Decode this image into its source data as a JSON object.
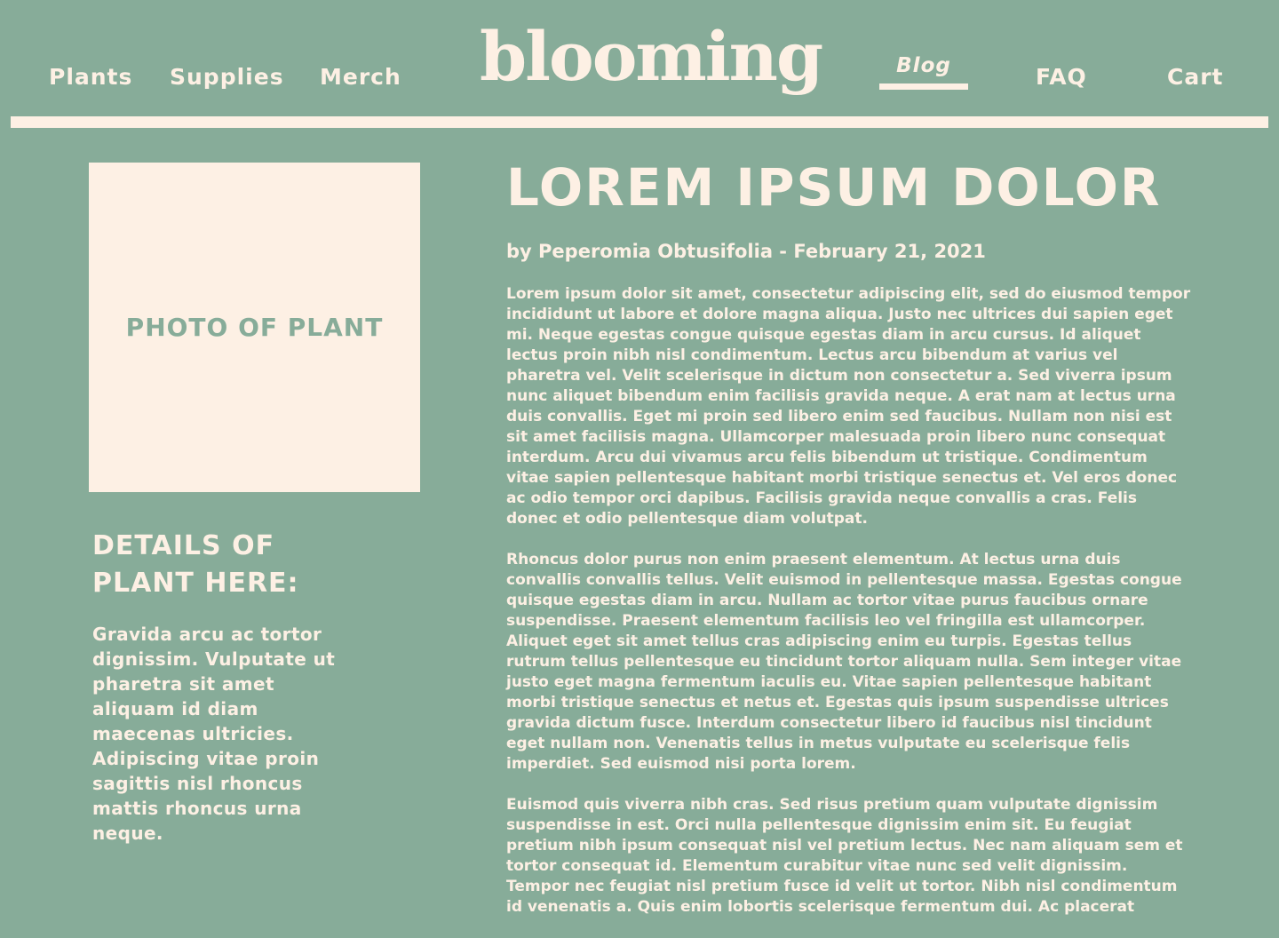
{
  "nav": {
    "plants": "Plants",
    "supplies": "Supplies",
    "merch": "Merch",
    "blog": "Blog",
    "faq": "FAQ",
    "cart": "Cart",
    "active": "Blog"
  },
  "logo": "blooming",
  "colors": {
    "background": "#87ac99",
    "cream": "#fdf0e4"
  },
  "sidebar": {
    "photo_placeholder": "PHOTO OF PLANT",
    "details_heading": "DETAILS OF PLANT HERE:",
    "details_body": "Gravida arcu ac tortor dignissim. Vulputate ut pharetra sit amet aliquam id diam maecenas ultricies. Adipiscing vitae proin sagittis nisl rhoncus mattis rhoncus urna neque."
  },
  "article": {
    "title": "LOREM IPSUM DOLOR",
    "byline": "by Peperomia Obtusifolia - February 21, 2021",
    "paragraphs": [
      "Lorem ipsum dolor sit amet, consectetur adipiscing elit, sed do eiusmod tempor incididunt ut labore et dolore magna aliqua. Justo nec ultrices dui sapien eget mi. Neque egestas congue quisque egestas diam in arcu cursus. Id aliquet lectus proin nibh nisl condimentum. Lectus arcu bibendum at varius vel pharetra vel. Velit scelerisque in dictum non consectetur a. Sed viverra ipsum nunc aliquet bibendum enim facilisis gravida neque. A erat nam at lectus urna duis convallis. Eget mi proin sed libero enim sed faucibus. Nullam non nisi est sit amet facilisis magna. Ullamcorper malesuada proin libero nunc consequat interdum. Arcu dui vivamus arcu felis bibendum ut tristique. Condimentum vitae sapien pellentesque habitant morbi tristique senectus et. Vel eros donec ac odio tempor orci dapibus. Facilisis gravida neque convallis a cras. Felis donec et odio pellentesque diam volutpat.",
      "Rhoncus dolor purus non enim praesent elementum. At lectus urna duis convallis convallis tellus. Velit euismod in pellentesque massa. Egestas congue quisque egestas diam in arcu. Nullam ac tortor vitae purus faucibus ornare suspendisse. Praesent elementum facilisis leo vel fringilla est ullamcorper. Aliquet eget sit amet tellus cras adipiscing enim eu turpis. Egestas tellus rutrum tellus pellentesque eu tincidunt tortor aliquam nulla. Sem integer vitae justo eget magna fermentum iaculis eu. Vitae sapien pellentesque habitant morbi tristique senectus et netus et. Egestas quis ipsum suspendisse ultrices gravida dictum fusce. Interdum consectetur libero id faucibus nisl tincidunt eget nullam non. Venenatis tellus in metus vulputate eu scelerisque felis imperdiet. Sed euismod nisi porta lorem.",
      "Euismod quis viverra nibh cras. Sed risus pretium quam vulputate dignissim suspendisse in est. Orci nulla pellentesque dignissim enim sit. Eu feugiat pretium nibh ipsum consequat nisl vel pretium lectus. Nec nam aliquam sem et tortor consequat id. Elementum curabitur vitae nunc sed velit dignissim. Tempor nec feugiat nisl pretium fusce id velit ut tortor. Nibh nisl condimentum id venenatis a. Quis enim lobortis scelerisque fermentum dui. Ac placerat"
    ]
  }
}
